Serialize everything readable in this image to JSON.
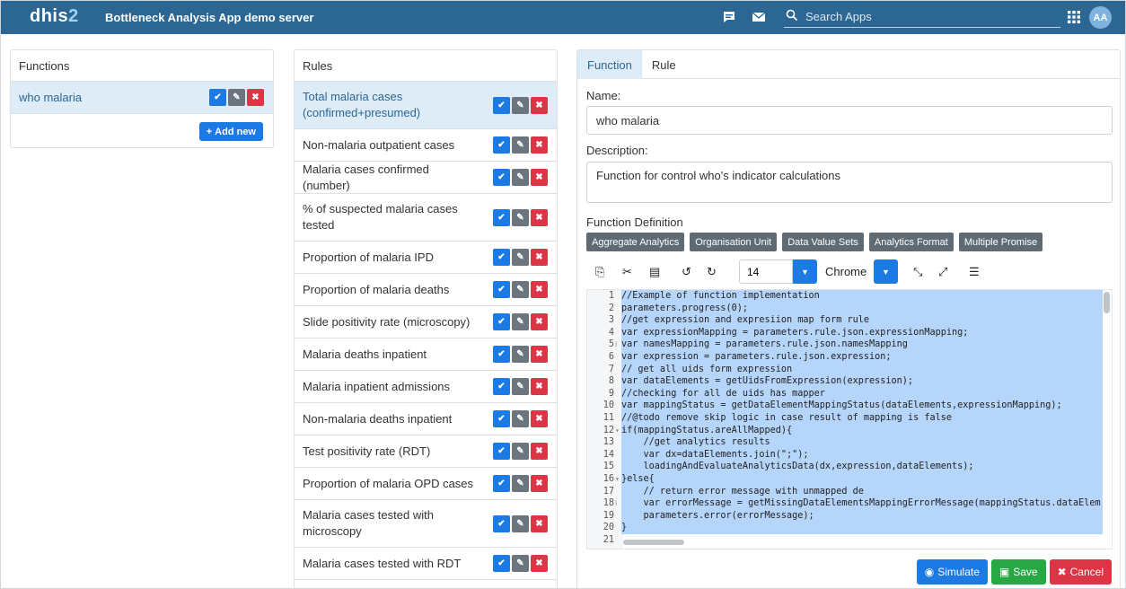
{
  "header": {
    "logo_main": "dhis",
    "logo_num": "2",
    "app_title": "Bottleneck Analysis App demo server",
    "search_placeholder": "Search Apps",
    "user_initials": "AA"
  },
  "functions_panel": {
    "title": "Functions",
    "items": [
      {
        "label": "who malaria"
      }
    ],
    "add_new_label": "Add new"
  },
  "rules_panel": {
    "title": "Rules",
    "items": [
      {
        "label": "Total malaria cases (confirmed+presumed)"
      },
      {
        "label": "Non-malaria outpatient cases"
      },
      {
        "label": "Malaria cases confirmed (number)"
      },
      {
        "label": "% of suspected malaria cases tested"
      },
      {
        "label": "Proportion of malaria IPD"
      },
      {
        "label": "Proportion of malaria deaths"
      },
      {
        "label": "Slide positivity rate (microscopy)"
      },
      {
        "label": "Malaria deaths inpatient"
      },
      {
        "label": "Malaria inpatient admissions"
      },
      {
        "label": "Non-malaria deaths inpatient"
      },
      {
        "label": "Test positivity rate (RDT)"
      },
      {
        "label": "Proportion of malaria OPD cases"
      },
      {
        "label": "Malaria cases tested with microscopy"
      },
      {
        "label": "Malaria cases tested with RDT"
      }
    ]
  },
  "editor": {
    "tabs": [
      "Function",
      "Rule"
    ],
    "name_label": "Name:",
    "name_value": "who malaria",
    "description_label": "Description:",
    "description_value": "Function for control who's indicator calculations",
    "definition_label": "Function Definition",
    "helpers": [
      "Aggregate Analytics",
      "Organisation Unit",
      "Data Value Sets",
      "Analytics Format",
      "Multiple Promise"
    ],
    "font_size": "14",
    "theme": "Chrome",
    "code_lines": [
      {
        "n": "1",
        "text": "//Example of function implementation"
      },
      {
        "n": "2",
        "text": "parameters.progress(0);"
      },
      {
        "n": "3",
        "text": "//get expression and expresiion map form rule"
      },
      {
        "n": "4",
        "text": "var expressionMapping = parameters.rule.json.expressionMapping;"
      },
      {
        "n": "5",
        "text": "var namesMapping = parameters.rule.json.namesMapping"
      },
      {
        "n": "6",
        "text": "var expression = parameters.rule.json.expression;"
      },
      {
        "n": "7",
        "text": "// get all uids form expression"
      },
      {
        "n": "8",
        "text": "var dataElements = getUidsFromExpression(expression);"
      },
      {
        "n": "9",
        "text": "//checking for all de uids has mapper"
      },
      {
        "n": "10",
        "text": "var mappingStatus = getDataElementMappingStatus(dataElements,expressionMapping);"
      },
      {
        "n": "11",
        "text": "//@todo remove skip logic in case result of mapping is false"
      },
      {
        "n": "12",
        "text": "if(mappingStatus.areAllMapped){"
      },
      {
        "n": "13",
        "text": "    //get analytics results"
      },
      {
        "n": "14",
        "text": "    var dx=dataElements.join(\";\");"
      },
      {
        "n": "15",
        "text": "    loadingAndEvaluateAnalyticsData(dx,expression,dataElements);"
      },
      {
        "n": "16",
        "text": "}else{"
      },
      {
        "n": "17",
        "text": "    // return error message with unmapped de"
      },
      {
        "n": "18",
        "text": "    var errorMessage = getMissingDataElementsMappingErrorMessage(mappingStatus.dataElem"
      },
      {
        "n": "19",
        "text": "    parameters.error(errorMessage);"
      },
      {
        "n": "20",
        "text": "}"
      },
      {
        "n": "21",
        "text": ""
      }
    ],
    "simulate_label": "Simulate",
    "save_label": "Save",
    "cancel_label": "Cancel"
  }
}
